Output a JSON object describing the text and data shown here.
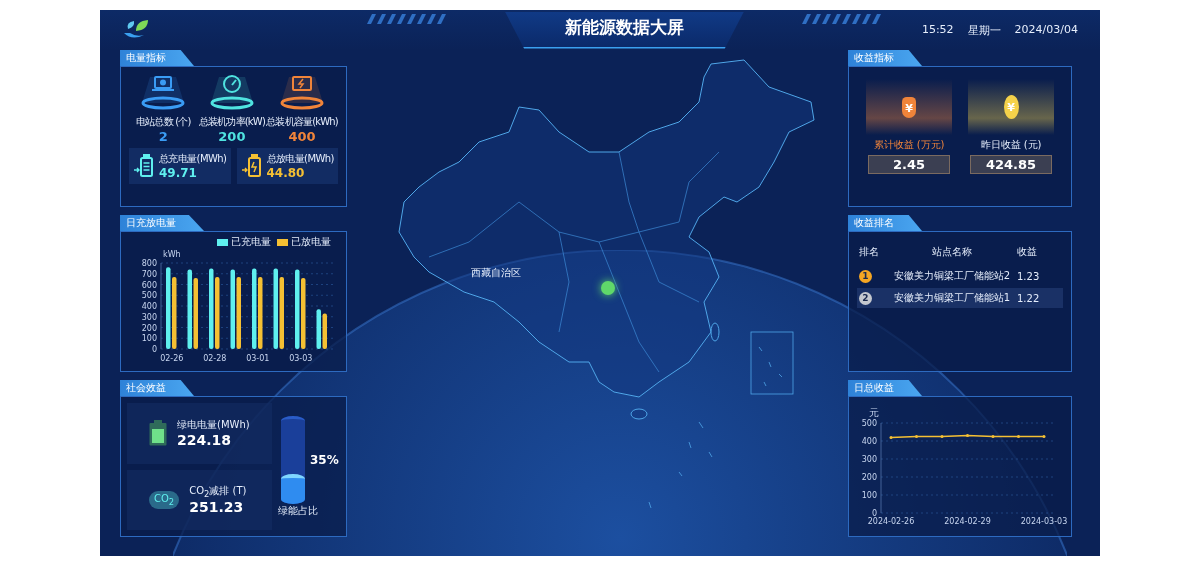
{
  "header": {
    "title": "新能源数据大屏",
    "time": "15:52",
    "weekday": "星期一",
    "date": "2024/03/04"
  },
  "power_metrics": {
    "title": "电量指标",
    "stats": [
      {
        "kind": "laptop",
        "label": "电站总数 (个)",
        "value": "2",
        "color": "#3a9cf5"
      },
      {
        "kind": "gauge",
        "label": "总装机功率(kW)",
        "value": "200",
        "color": "#4fe3e0"
      },
      {
        "kind": "battery_board",
        "label": "总装机容量(kWh)",
        "value": "400",
        "color": "#f0843a"
      }
    ],
    "totals": [
      {
        "kind": "charge",
        "label": "总充电量(MWh)",
        "value": "49.71",
        "color": "#5ff0ef"
      },
      {
        "kind": "discharge",
        "label": "总放电量(MWh)",
        "value": "44.80",
        "color": "#f5c033"
      }
    ]
  },
  "daily_charge": {
    "title": "日充放电量",
    "chart_data": {
      "type": "bar",
      "ylabel": "kWh",
      "ylim": [
        0,
        800
      ],
      "yticks": [
        0,
        100,
        200,
        300,
        400,
        500,
        600,
        700,
        800
      ],
      "grid": true,
      "categories": [
        "02-26",
        null,
        "02-28",
        null,
        "03-01",
        null,
        "03-03",
        null
      ],
      "series": [
        {
          "name": "已充电量",
          "color": "#5ff0ef",
          "values": [
            760,
            740,
            750,
            740,
            750,
            750,
            740,
            370
          ]
        },
        {
          "name": "已放电量",
          "color": "#f5c033",
          "values": [
            670,
            660,
            670,
            670,
            670,
            670,
            660,
            330
          ]
        }
      ]
    }
  },
  "social_benefit": {
    "title": "社会效益",
    "items": [
      {
        "kind": "battery",
        "label": "绿电电量(MWh)",
        "value": "224.18"
      },
      {
        "kind": "co2",
        "icon_text": "CO$_{2}$",
        "label": "CO$_{2}$减排 (T)",
        "value": "251.23"
      }
    ],
    "green_share": {
      "label": "绿能占比",
      "reading": "35%",
      "level": 0.35
    }
  },
  "map": {
    "region_label": "西藏自治区"
  },
  "revenue_metrics": {
    "title": "收益指标",
    "cards": [
      {
        "kind": "bag",
        "icon_text": "¥",
        "label": "累计收益 (万元)",
        "value": "2.45",
        "color": "#f0843a"
      },
      {
        "kind": "coin",
        "icon_text": "¥",
        "label": "昨日收益 (元)",
        "value": "424.85",
        "color": "#f5d24a"
      }
    ]
  },
  "revenue_ranking": {
    "title": "收益排名",
    "columns": [
      "排名",
      "站点名称",
      "收益"
    ],
    "rows": [
      {
        "rank": "1",
        "color": "#f5a623",
        "name": "安徽美力铜梁工厂储能站2",
        "revenue": "1.23"
      },
      {
        "rank": "2",
        "color": "#c4c8cf",
        "name": "安徽美力铜梁工厂储能站1",
        "revenue": "1.22"
      }
    ]
  },
  "daily_revenue": {
    "title": "日总收益",
    "chart_data": {
      "type": "line",
      "ylabel": "元",
      "ylim": [
        0,
        500
      ],
      "yticks": [
        0,
        100,
        200,
        300,
        400,
        500
      ],
      "grid": true,
      "categories": [
        "2024-02-26",
        null,
        null,
        "2024-02-29",
        null,
        null,
        "2024-03-03"
      ],
      "series": [
        {
          "color": "#f5c033",
          "values": [
            420,
            425,
            425,
            430,
            425,
            425,
            425
          ]
        }
      ]
    }
  }
}
